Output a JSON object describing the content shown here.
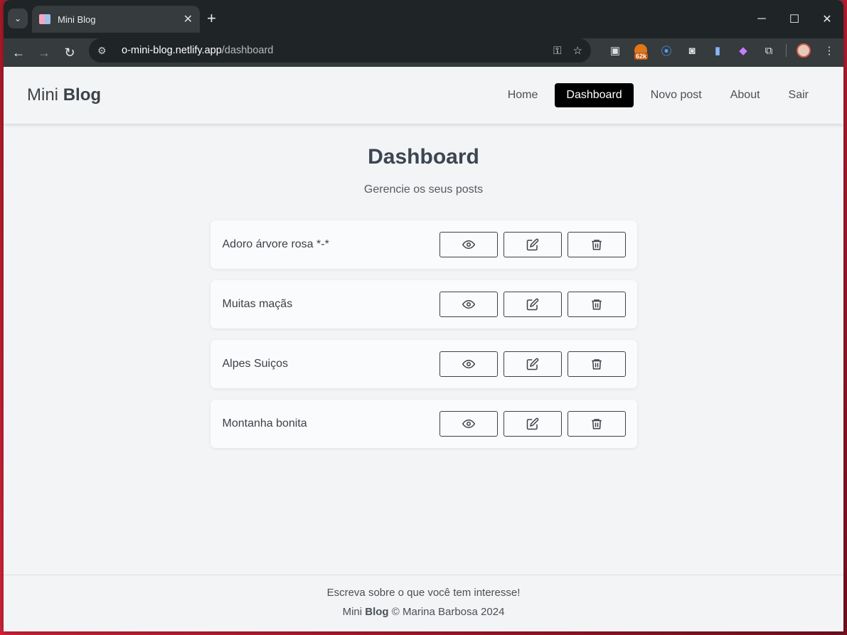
{
  "browser": {
    "tab_title": "Mini Blog",
    "url_host": "o-mini-blog.netlify.app",
    "url_path": "/dashboard",
    "extension_badge": "62k"
  },
  "navbar": {
    "brand_light": "Mini",
    "brand_bold": "Blog",
    "links": [
      {
        "label": "Home",
        "active": false
      },
      {
        "label": "Dashboard",
        "active": true
      },
      {
        "label": "Novo post",
        "active": false
      },
      {
        "label": "About",
        "active": false
      },
      {
        "label": "Sair",
        "active": false
      }
    ]
  },
  "main": {
    "title": "Dashboard",
    "subtitle": "Gerencie os seus posts",
    "posts": [
      {
        "title": "Adoro árvore rosa *-*"
      },
      {
        "title": "Muitas maçãs"
      },
      {
        "title": "Alpes Suiços"
      },
      {
        "title": "Montanha bonita"
      }
    ],
    "action_icons": [
      "eye-icon",
      "edit-icon",
      "trash-icon"
    ]
  },
  "footer": {
    "tagline": "Escreva sobre o que você tem interesse!",
    "brand_light": "Mini",
    "brand_bold": "Blog",
    "copyright": "© Marina Barbosa 2024"
  },
  "colors": {
    "active_nav_bg": "#000000",
    "text_dark": "#3c4248",
    "page_bg": "#f3f4f5"
  }
}
